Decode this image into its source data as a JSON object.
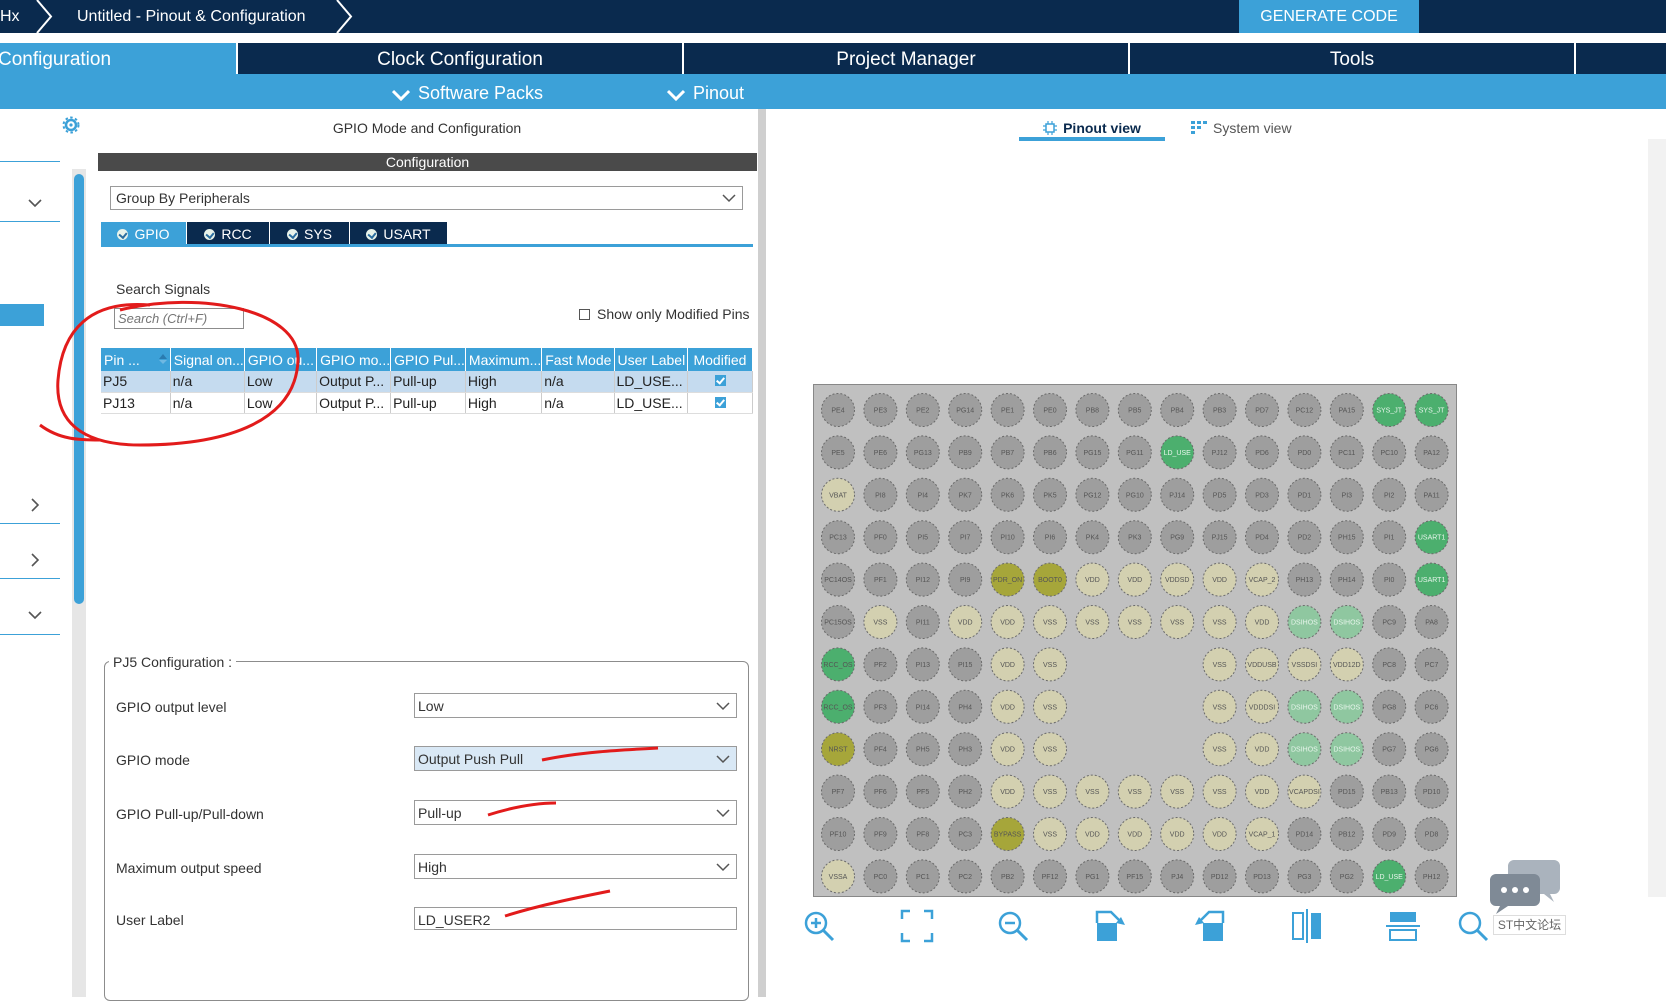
{
  "app": {
    "breadcrumb_prefix": "Hx",
    "breadcrumb_title": "Untitled - Pinout & Configuration",
    "generate_code": "GENERATE CODE"
  },
  "main_tabs": [
    {
      "label": "Configuration"
    },
    {
      "label": "Clock Configuration"
    },
    {
      "label": "Project Manager"
    },
    {
      "label": "Tools"
    }
  ],
  "sub_menu": [
    {
      "label": "Software Packs"
    },
    {
      "label": "Pinout"
    }
  ],
  "middle": {
    "header": "GPIO Mode and Configuration",
    "configuration_bar": "Configuration",
    "group_select": "Group By Peripherals",
    "peripheral_tabs": [
      "GPIO",
      "RCC",
      "SYS",
      "USART"
    ],
    "search_label": "Search Signals",
    "search_placeholder": "Search (Ctrl+F)",
    "show_modified_label": "Show only Modified Pins",
    "table_headers": [
      "Pin ...",
      "Signal on...",
      "GPIO ou...",
      "GPIO mo...",
      "GPIO Pul...",
      "Maximum...",
      "Fast Mode",
      "User Label",
      "Modified"
    ],
    "rows": [
      {
        "pin": "PJ5",
        "signal": "n/a",
        "output": "Low",
        "mode": "Output P...",
        "pull": "Pull-up",
        "speed": "High",
        "fast": "n/a",
        "label": "LD_USE...",
        "modified": true
      },
      {
        "pin": "PJ13",
        "signal": "n/a",
        "output": "Low",
        "mode": "Output P...",
        "pull": "Pull-up",
        "speed": "High",
        "fast": "n/a",
        "label": "LD_USE...",
        "modified": true
      }
    ],
    "pin_config_title": "PJ5 Configuration :",
    "config_fields": [
      {
        "label": "GPIO output level",
        "value": "Low"
      },
      {
        "label": "GPIO mode",
        "value": "Output Push Pull"
      },
      {
        "label": "GPIO Pull-up/Pull-down",
        "value": "Pull-up"
      },
      {
        "label": "Maximum output speed",
        "value": "High"
      },
      {
        "label": "User Label",
        "value": "LD_USER2"
      }
    ]
  },
  "right": {
    "pinout_view": "Pinout view",
    "system_view": "System view",
    "chip_rows": [
      [
        "PE4",
        "PE3",
        "PE2",
        "PG14",
        "PE1",
        "PE0",
        "PB8",
        "PB5",
        "PB4",
        "PB3",
        "PD7",
        "PC12",
        "PA15",
        "SYS_JT",
        "SYS_JT"
      ],
      [
        "PE5",
        "PE6",
        "PG13",
        "PB9",
        "PB7",
        "PB6",
        "PG15",
        "PG11",
        "LD_USE",
        "PJ12",
        "PD6",
        "PD0",
        "PC11",
        "PC10",
        "PA12"
      ],
      [
        "VBAT",
        "PI8",
        "PI4",
        "PK7",
        "PK6",
        "PK5",
        "PG12",
        "PG10",
        "PJ14",
        "PD5",
        "PD3",
        "PD1",
        "PI3",
        "PI2",
        "PA11"
      ],
      [
        "PC13",
        "PF0",
        "PI5",
        "PI7",
        "PI10",
        "PI6",
        "PK4",
        "PK3",
        "PG9",
        "PJ15",
        "PD4",
        "PD2",
        "PH15",
        "PI1",
        "USART1"
      ],
      [
        "PC14OS",
        "PF1",
        "PI12",
        "PI9",
        "PDR_ON",
        "BOOT0",
        "VDD",
        "VDD",
        "VDDSD",
        "VDD",
        "VCAP_2",
        "PH13",
        "PH14",
        "PI0",
        "USART1"
      ],
      [
        "PC15OS",
        "VSS",
        "PI11",
        "VDD",
        "VDD",
        "VSS",
        "VSS",
        "VSS",
        "VSS",
        "VSS",
        "VDD",
        "DSIHOS",
        "DSIHOS",
        "PC9",
        "PA8"
      ],
      [
        "RCC_OS",
        "PF2",
        "PI13",
        "PI15",
        "VDD",
        "VSS",
        "",
        "",
        "",
        "VSS",
        "VDDUSB",
        "VSSDSI",
        "VDD12D",
        "PC8",
        "PC7"
      ],
      [
        "RCC_OS",
        "PF3",
        "PI14",
        "PH4",
        "VDD",
        "VSS",
        "",
        "",
        "",
        "VSS",
        "VDDDSI",
        "DSIHOS",
        "DSIHOS",
        "PG8",
        "PC6"
      ],
      [
        "NRST",
        "PF4",
        "PH5",
        "PH3",
        "VDD",
        "VSS",
        "",
        "",
        "",
        "VSS",
        "VDD",
        "DSIHOS",
        "DSIHOS",
        "PG7",
        "PG6"
      ],
      [
        "PF7",
        "PF6",
        "PF5",
        "PH2",
        "VDD",
        "VSS",
        "VSS",
        "VSS",
        "VSS",
        "VSS",
        "VDD",
        "VCAPDSI",
        "PD15",
        "PB13",
        "PD10"
      ],
      [
        "PF10",
        "PF9",
        "PF8",
        "PC3",
        "BYPASS",
        "VSS",
        "VDD",
        "VDD",
        "VDD",
        "VDD",
        "VCAP_1",
        "PD14",
        "PB12",
        "PD9",
        "PD8"
      ],
      [
        "VSSA",
        "PC0",
        "PC1",
        "PC2",
        "PB2",
        "PF12",
        "PG1",
        "PF15",
        "PJ4",
        "PD12",
        "PD13",
        "PG3",
        "PG2",
        "LD_USE",
        "PH12"
      ]
    ],
    "colors": {
      "gray": "#9e9e9e",
      "power": "#d3d0b0",
      "green": "#4caf6e",
      "olive": "#a6a63a",
      "paleGreen": "#8fc7a0"
    }
  },
  "watermark": "ST中文论坛"
}
